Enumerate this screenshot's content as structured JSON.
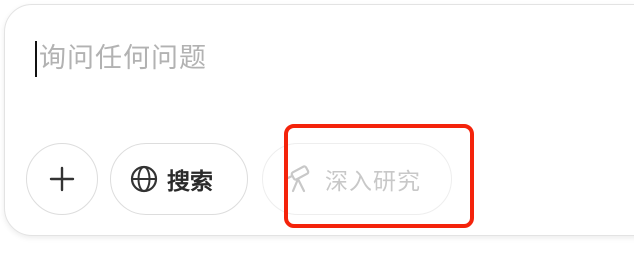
{
  "composer": {
    "placeholder": "询问任何问题"
  },
  "toolbar": {
    "attach_icon": "plus-icon",
    "search": {
      "icon": "globe-icon",
      "label": "搜索"
    },
    "deep_research": {
      "icon": "telescope-icon",
      "label": "深入研究",
      "state": "disabled"
    }
  },
  "annotation": {
    "highlight_color": "#f4230b"
  }
}
